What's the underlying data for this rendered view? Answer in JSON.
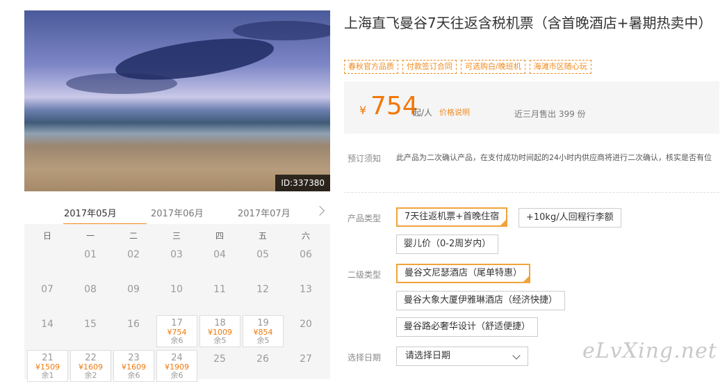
{
  "photo": {
    "id_label": "ID:337380"
  },
  "product": {
    "title": "上海直飞曼谷7天往返含税机票（含首晚酒店+暑期热卖中）",
    "tags": [
      "春秋官方品质",
      "付款签订合同",
      "可选购白/晚班机",
      "海滩市区随心玩"
    ]
  },
  "price": {
    "currency": "¥",
    "amount": "754",
    "unit": "起/人",
    "explain_link": "价格说明",
    "sold": "近三月售出 399 份"
  },
  "notice": {
    "label": "预订须知",
    "text": "此产品为二次确认产品，在支付成功时间起的24小时内供应商将进行二次确认，核实是否有位"
  },
  "product_type": {
    "label": "产品类型",
    "options": [
      "7天往返机票+首晚住宿",
      "+10kg/人回程行李额",
      "婴儿价（0-2周岁内）"
    ],
    "selected": 0
  },
  "sub_type": {
    "label": "二级类型",
    "options": [
      "曼谷文尼瑟酒店（尾单特惠）",
      "曼谷大象大厦伊雅琳酒店（经济快捷）",
      "曼谷路必奢华设计（舒适便捷）"
    ],
    "selected": 0
  },
  "date_select": {
    "label": "选择日期",
    "value": "请选择日期"
  },
  "watermark": "eLvXing.net",
  "calendar": {
    "months": [
      "2017年05月",
      "2017年06月",
      "2017年07月"
    ],
    "active_month": 0,
    "weekdays": [
      "日",
      "一",
      "二",
      "三",
      "四",
      "五",
      "六"
    ],
    "plain_days": [
      "01",
      "02",
      "03",
      "04",
      "05",
      "06",
      "07",
      "08",
      "09",
      "10",
      "11",
      "12",
      "13",
      "14",
      "15",
      "16",
      "20",
      "25",
      "26",
      "27"
    ],
    "priced_days": [
      {
        "day": "17",
        "price": "¥754",
        "remain": "余6"
      },
      {
        "day": "18",
        "price": "¥1009",
        "remain": "余5"
      },
      {
        "day": "19",
        "price": "¥854",
        "remain": "余5"
      },
      {
        "day": "21",
        "price": "¥1509",
        "remain": "余1"
      },
      {
        "day": "22",
        "price": "¥1609",
        "remain": "余2"
      },
      {
        "day": "23",
        "price": "¥1609",
        "remain": "余6"
      },
      {
        "day": "24",
        "price": "¥1909",
        "remain": "余6"
      }
    ]
  },
  "colors": {
    "accent": "#f0780a",
    "tag_border": "#f08a1e",
    "selected_border": "#f0a33a"
  }
}
